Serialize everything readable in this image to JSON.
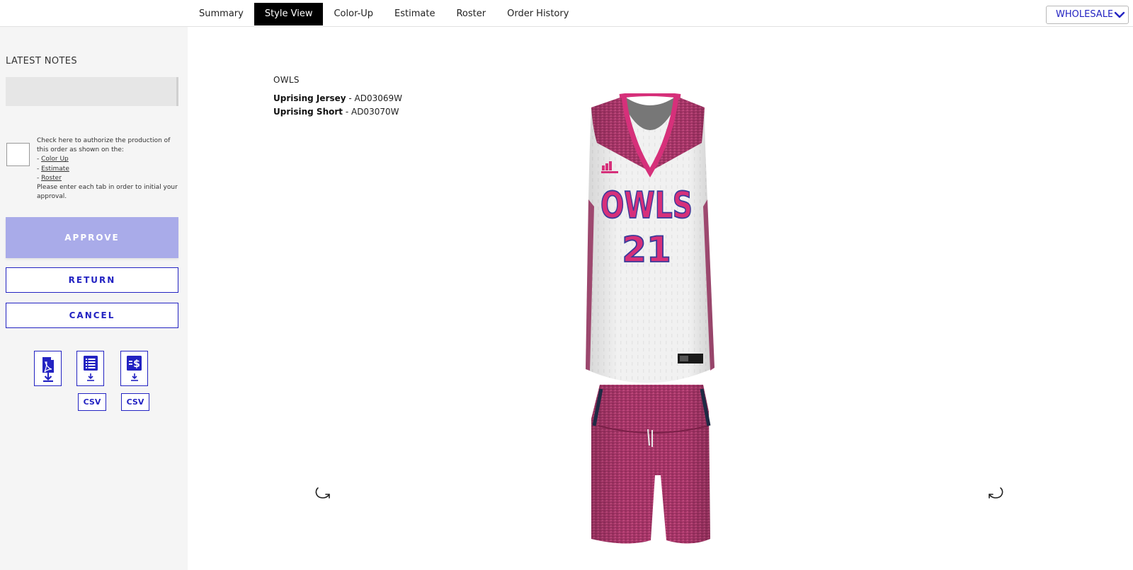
{
  "nav": {
    "tabs": [
      {
        "label": "Summary",
        "active": false
      },
      {
        "label": "Style View",
        "active": true
      },
      {
        "label": "Color-Up",
        "active": false
      },
      {
        "label": "Estimate",
        "active": false
      },
      {
        "label": "Roster",
        "active": false
      },
      {
        "label": "Order History",
        "active": false
      }
    ],
    "pricing_select": {
      "selected": "WHOLESALE"
    }
  },
  "sidebar": {
    "notes_title": "LATEST NOTES",
    "authorize": {
      "intro": "Check here to authorize the production of this order as shown on the:",
      "links": [
        "Color Up",
        "Estimate",
        "Roster"
      ],
      "outro": "Please enter each tab in order to initial your approval."
    },
    "buttons": {
      "approve": "APPROVE",
      "return": "RETURN",
      "cancel": "CANCEL"
    },
    "downloads": {
      "csv_label_1": "CSV",
      "csv_label_2": "CSV"
    }
  },
  "main": {
    "team_name": "OWLS",
    "items": [
      {
        "name": "Uprising Jersey",
        "code": "AD03069W"
      },
      {
        "name": "Uprising Short",
        "code": "AD03070W"
      }
    ],
    "jersey_text": "OWLS",
    "jersey_number": "21"
  },
  "colors": {
    "accent": "#2323c2",
    "approve_bg": "#a9abe9",
    "jersey_pink": "#d6307a",
    "heather_pink": "#a33466"
  },
  "icons": [
    "pdf-download-icon",
    "roster-list-download-icon",
    "estimate-dollar-download-icon",
    "rotate-left-icon",
    "rotate-right-icon",
    "chevron-down-icon"
  ]
}
